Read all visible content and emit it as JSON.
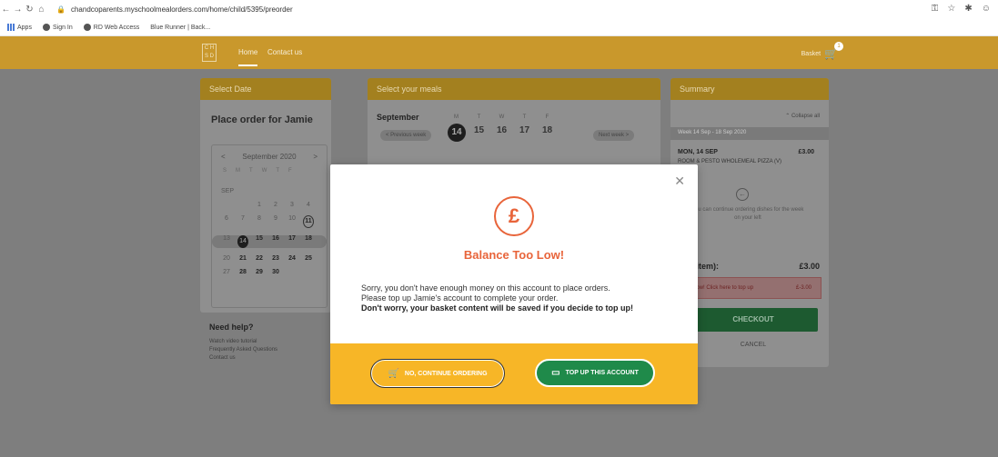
{
  "browser": {
    "url": "chandcoparents.myschoolmealorders.com/home/child/5395/preorder",
    "bookmarks": [
      "Apps",
      "Sign In",
      "RD Web Access",
      "Blue Runner | Back..."
    ]
  },
  "header": {
    "logo": "C H S D",
    "nav": [
      "Home",
      "Contact us"
    ],
    "basket_label": "Basket",
    "basket_count": "1"
  },
  "select_date": {
    "header": "Select Date",
    "title": "Place order for Jamie",
    "calendar_month": "September 2020",
    "dow": [
      "S",
      "M",
      "T",
      "W",
      "T",
      "F"
    ],
    "section": "SEP",
    "rows": [
      [
        "",
        "",
        "1",
        "2",
        "3",
        "4"
      ],
      [
        "6",
        "7",
        "8",
        "9",
        "10",
        "11"
      ],
      [
        "13",
        "14",
        "15",
        "16",
        "17",
        "18"
      ],
      [
        "20",
        "21",
        "22",
        "23",
        "24",
        "25"
      ],
      [
        "27",
        "28",
        "29",
        "30",
        "",
        ""
      ]
    ]
  },
  "help": {
    "title": "Need help?",
    "links": [
      "Watch video tutorial",
      "Frequently Asked Questions",
      "Contact us"
    ]
  },
  "select_meals": {
    "header": "Select your meals",
    "month": "September",
    "prev": "< Previous week",
    "next": "Next week >",
    "days": [
      {
        "dow": "M",
        "num": "14"
      },
      {
        "dow": "T",
        "num": "15"
      },
      {
        "dow": "W",
        "num": "16"
      },
      {
        "dow": "T",
        "num": "17"
      },
      {
        "dow": "F",
        "num": "18"
      }
    ]
  },
  "summary": {
    "header": "Summary",
    "collapse": "Collapse all",
    "week": "Week 14 Sep - 18 Sep 2020",
    "meal_day": "MON, 14 SEP",
    "meal_price": "£3.00",
    "meal_name": "ROOM & PESTO WHOLEMEAL PIZZA (V)",
    "continue_text": "You can continue ordering dishes for the week on your left",
    "total_label": "al (1 item):",
    "total_value": "£3.00",
    "low_text": "ce low! Click here to top up",
    "low_value": "£-3.00",
    "checkout": "CHECKOUT",
    "cancel": "CANCEL"
  },
  "modal": {
    "icon": "£",
    "title": "Balance Too Low!",
    "line1": "Sorry, you don't have enough money on this account to place orders.",
    "line2": "Please top up Jamie's account to complete your order.",
    "line3": "Don't worry, your basket content will be saved if you decide to top up!",
    "btn_continue": "NO, CONTINUE ORDERING",
    "btn_topup": "TOP UP THIS ACCOUNT",
    "accent": "#e8643a",
    "footer_color": "#f7b627",
    "green": "#1f8a4a"
  }
}
